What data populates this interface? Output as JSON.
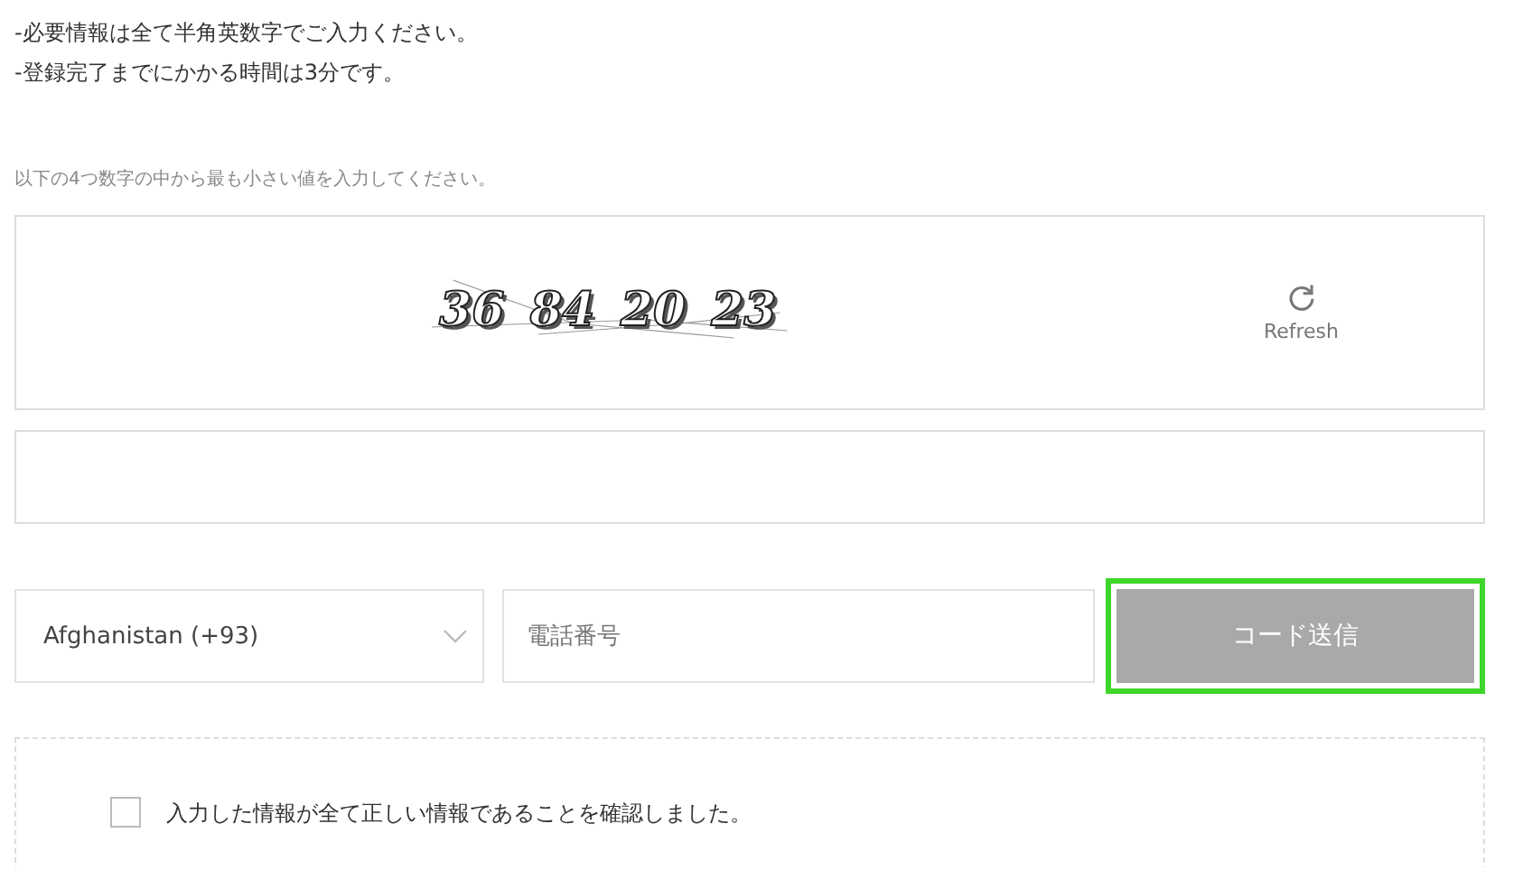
{
  "notes": [
    "-必要情報は全て半角英数字でご入力ください。",
    "-登録完了までにかかる時間は3分です。"
  ],
  "captcha": {
    "instruction": "以下の4つ数字の中から最も小さい値を入力してください。",
    "numbers": [
      "36",
      "84",
      "20",
      "23"
    ],
    "refresh_label": "Refresh"
  },
  "phone": {
    "country": "Afghanistan (+93)",
    "placeholder": "電話番号",
    "send_button": {
      "label": "コード送信",
      "disabled": true,
      "highlighted": true
    }
  },
  "confirm": {
    "label": "入力した情報が全て正しい情報であることを確認しました。",
    "checked": false
  }
}
